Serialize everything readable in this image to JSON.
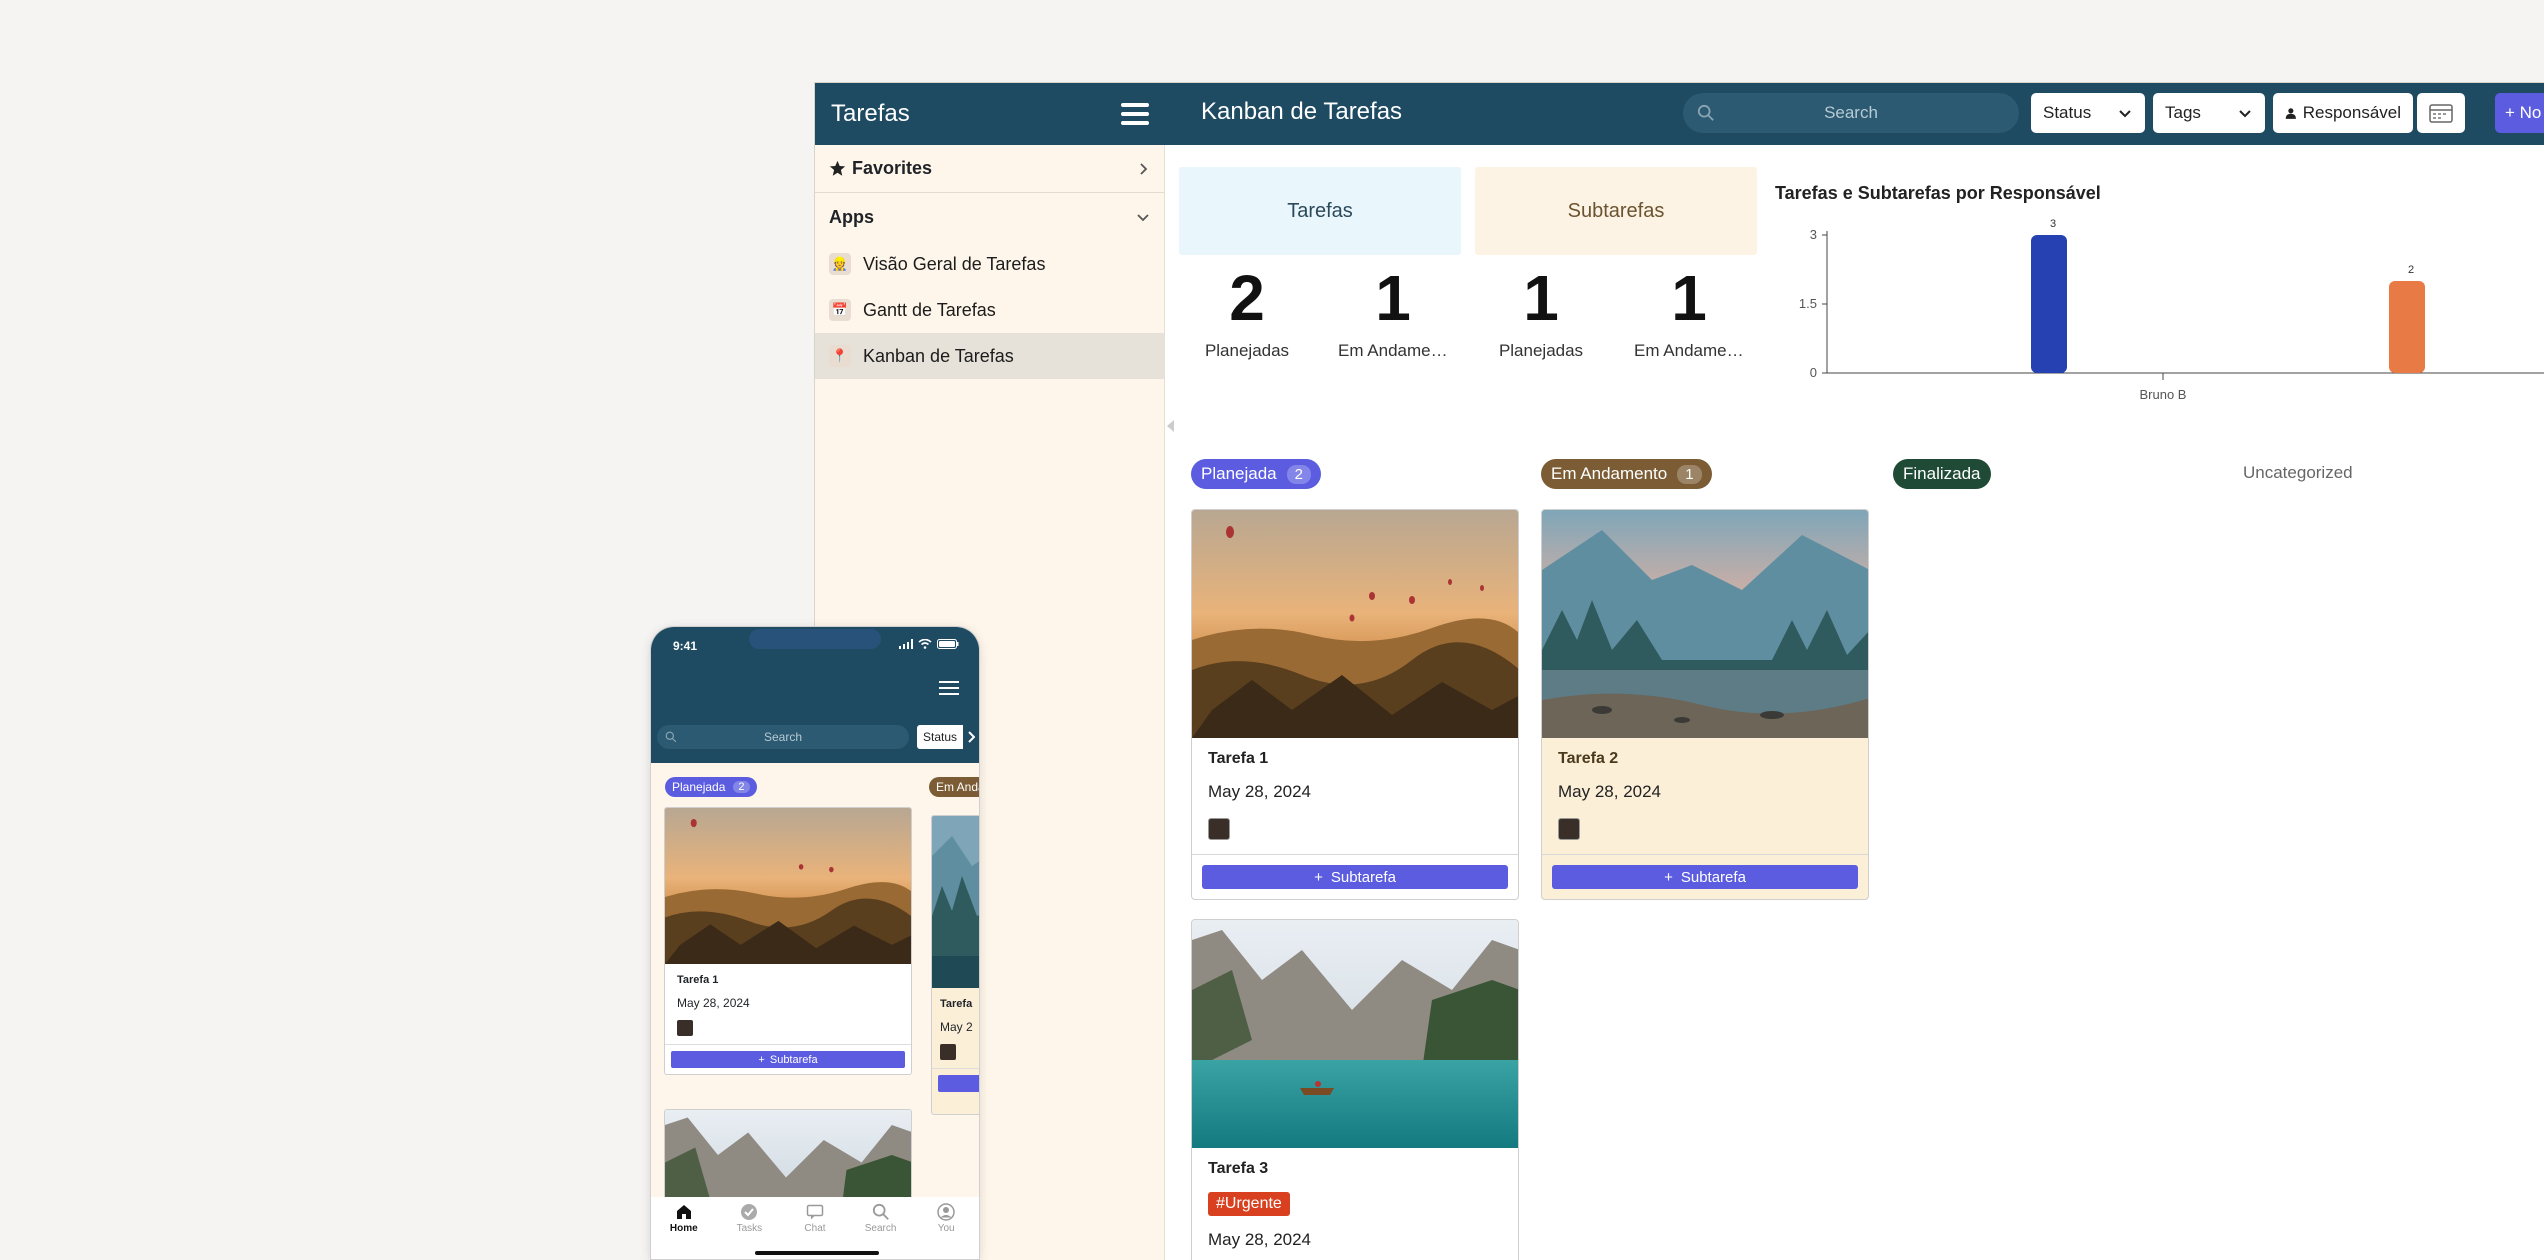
{
  "sidebar": {
    "title": "Tarefas",
    "sections": {
      "favorites": "Favorites",
      "apps": "Apps"
    },
    "items": [
      {
        "label": "Visão Geral de Tarefas",
        "icon": "kanban-app-icon"
      },
      {
        "label": "Gantt de Tarefas",
        "icon": "calendar-app-icon"
      },
      {
        "label": "Kanban de Tarefas",
        "icon": "pin-app-icon",
        "active": true
      }
    ]
  },
  "header": {
    "title": "Kanban de Tarefas",
    "search_placeholder": "Search",
    "filters": {
      "status": "Status",
      "tags": "Tags",
      "responsavel": "Responsável"
    },
    "new_label": "+ No"
  },
  "stats": {
    "tarefas": {
      "label": "Tarefas",
      "planned_count": "2",
      "planned_label": "Planejadas",
      "progress_count": "1",
      "progress_label": "Em Andamento"
    },
    "subtarefas": {
      "label": "Subtarefas",
      "planned_count": "1",
      "planned_label": "Planejadas",
      "progress_count": "1",
      "progress_label": "Em Andamento"
    }
  },
  "chart_data": {
    "type": "bar",
    "title": "Tarefas e Subtarefas por Responsável",
    "categories": [
      "Bruno B"
    ],
    "series": [
      {
        "values": [
          3
        ],
        "color": "#2541b2"
      },
      {
        "values": [
          2
        ],
        "color": "#e87a45"
      }
    ],
    "yticks": [
      "3",
      "1.5",
      "0"
    ],
    "ylim": [
      0,
      3
    ]
  },
  "columns": [
    {
      "label": "Planejada",
      "count": "2",
      "color": "#5b5ce0"
    },
    {
      "label": "Em Andamento",
      "count": "1",
      "color": "#7b5c34"
    },
    {
      "label": "Finalizada",
      "count": "",
      "color": "#1f4a35"
    },
    {
      "label": "Uncategorized",
      "count": "",
      "color": ""
    }
  ],
  "cards": [
    {
      "title": "Tarefa 1",
      "date": "May 28, 2024",
      "button": "Subtarefa"
    },
    {
      "title": "Tarefa 2",
      "date": "May 28, 2024",
      "button": "Subtarefa"
    },
    {
      "title": "Tarefa 3",
      "tag": "#Urgente",
      "date": "May 28, 2024"
    }
  ],
  "phone": {
    "time": "9:41",
    "search_placeholder": "Search",
    "filter_label": "Status",
    "col1_label": "Planejada",
    "col1_count": "2",
    "col2_label": "Em Andamento",
    "card1_title": "Tarefa 1",
    "card1_date": "May 28, 2024",
    "card1_button": "Subtarefa",
    "card2_title": "Tarefa",
    "card2_date": "May 2",
    "nav": [
      "Home",
      "Tasks",
      "Chat",
      "Search",
      "You"
    ]
  }
}
